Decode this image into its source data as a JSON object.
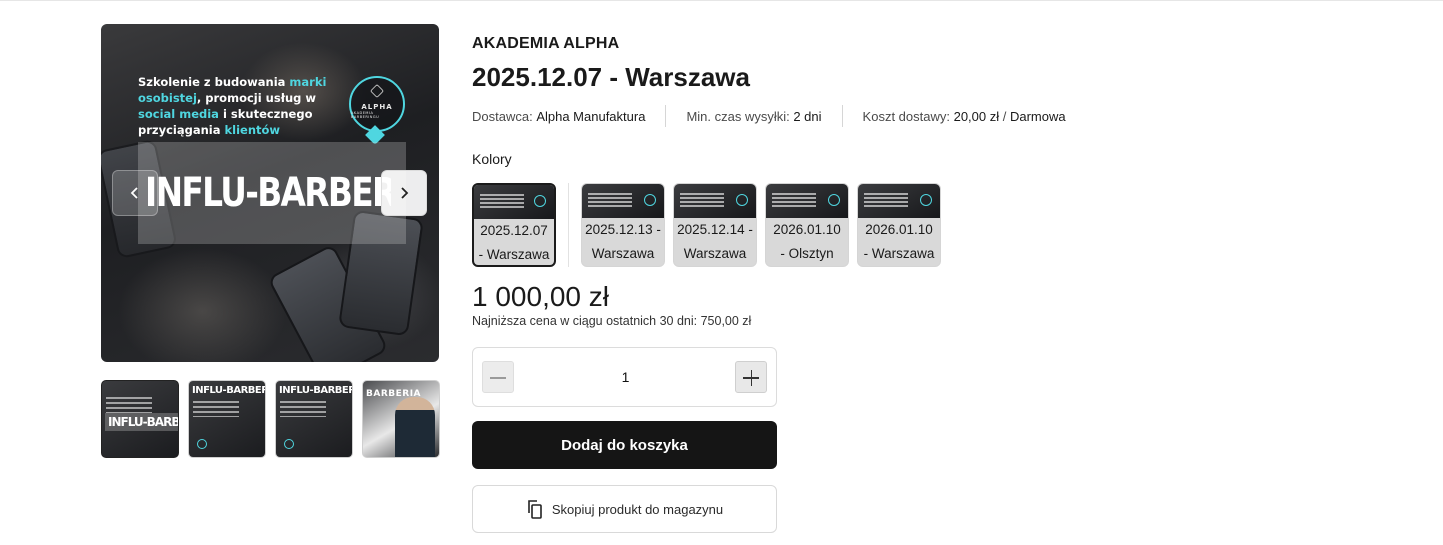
{
  "gallery": {
    "main_image": {
      "promo_text": {
        "parts": [
          {
            "text": "Szkolenie z budowania ",
            "highlight": false
          },
          {
            "text": "marki osobistej",
            "highlight": true
          },
          {
            "text": ", promocji usług w ",
            "highlight": false
          },
          {
            "text": "social media",
            "highlight": true
          },
          {
            "text": " i skutecznego przyciągania ",
            "highlight": false
          },
          {
            "text": "klientów",
            "highlight": true
          }
        ]
      },
      "badge_brand": "ALPHA",
      "badge_sub": "AKADEMIA BARBERINGU",
      "big_title": "INFLU-BARBER"
    },
    "prev_icon": "chevron-left-icon",
    "next_icon": "chevron-right-icon",
    "thumbnails": [
      {
        "title": "INFLU-BARBER"
      },
      {
        "title": "INFLU-BARBER"
      },
      {
        "title": "INFLU-BARBER"
      },
      {
        "title": "BARBERIA"
      }
    ]
  },
  "product": {
    "brand": "AKADEMIA ALPHA",
    "title": "2025.12.07 - Warszawa",
    "meta": {
      "supplier_label": "Dostawca: ",
      "supplier_value": "Alpha Manufaktura",
      "shipping_time_label": "Min. czas wysyłki: ",
      "shipping_time_value": "2 dni",
      "delivery_cost_label": "Koszt dostawy: ",
      "delivery_cost_value": "20,00 zł",
      "delivery_sep": " / ",
      "delivery_free": "Darmowa"
    },
    "colors_label": "Kolory",
    "variants": [
      {
        "line1": "2025.12.07",
        "line2": "- Warszawa",
        "selected": true
      },
      {
        "line1": "2025.12.13 -",
        "line2": "Warszawa",
        "selected": false
      },
      {
        "line1": "2025.12.14 -",
        "line2": "Warszawa",
        "selected": false
      },
      {
        "line1": "2026.01.10",
        "line2": "- Olsztyn",
        "selected": false
      },
      {
        "line1": "2026.01.10",
        "line2": "- Warszawa",
        "selected": false
      }
    ],
    "price": "1 000,00 zł",
    "lowest_price": "Najniższa cena w ciągu ostatnich 30 dni: 750,00 zł",
    "quantity": "1",
    "add_to_cart": "Dodaj do koszyka",
    "copy_to_store": "Skopiuj produkt do magazynu",
    "accent_color": "#4fd6e0"
  }
}
